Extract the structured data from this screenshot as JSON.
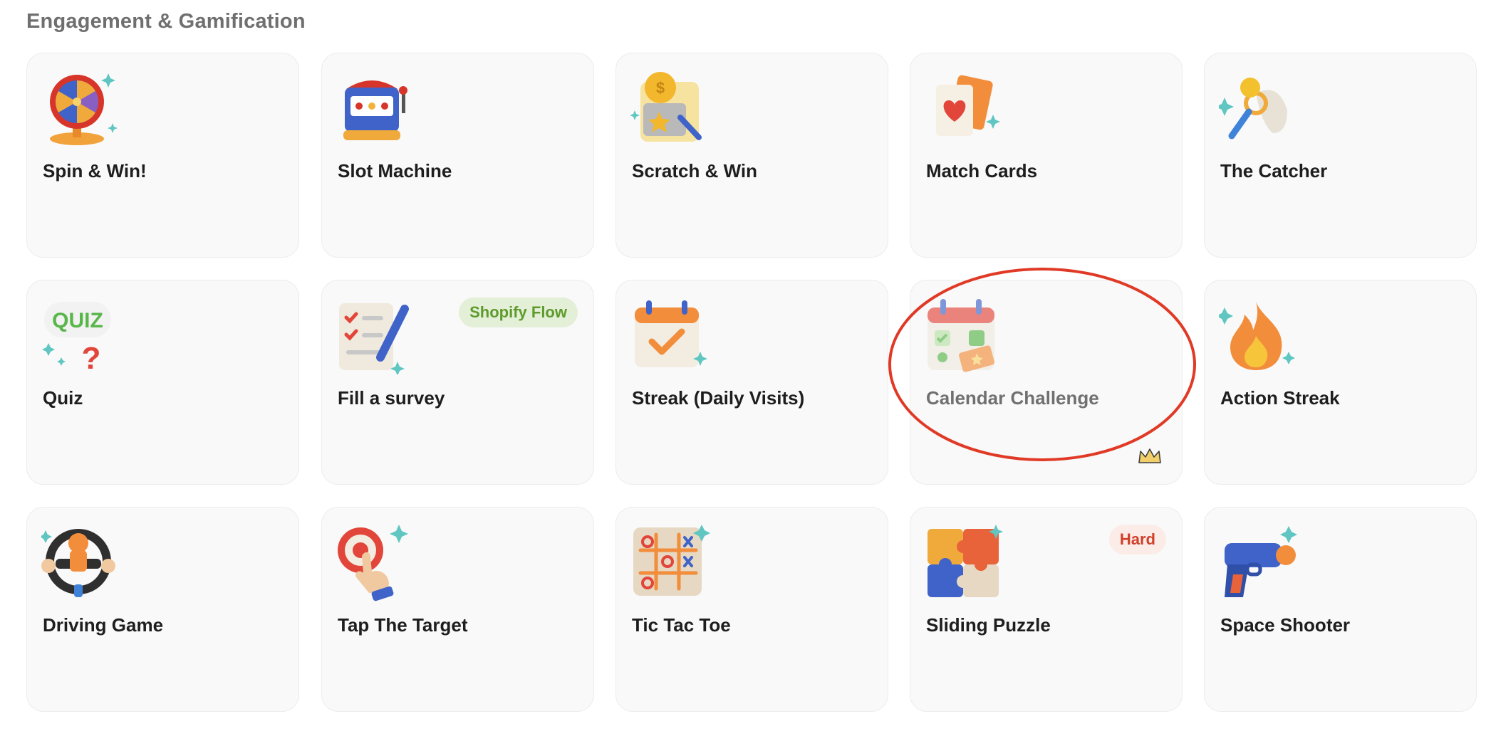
{
  "section": {
    "title": "Engagement & Gamification"
  },
  "cards": [
    {
      "label": "Spin & Win!",
      "icon": "spin-wheel-icon"
    },
    {
      "label": "Slot Machine",
      "icon": "slot-machine-icon"
    },
    {
      "label": "Scratch & Win",
      "icon": "scratch-card-icon"
    },
    {
      "label": "Match Cards",
      "icon": "playing-cards-icon"
    },
    {
      "label": "The Catcher",
      "icon": "catcher-net-icon"
    },
    {
      "label": "Quiz",
      "icon": "quiz-icon"
    },
    {
      "label": "Fill a survey",
      "icon": "survey-checklist-icon",
      "badge": "Shopify Flow"
    },
    {
      "label": "Streak (Daily Visits)",
      "icon": "calendar-check-icon"
    },
    {
      "label": "Calendar Challenge",
      "icon": "calendar-challenge-icon",
      "premium": true,
      "disabled": true
    },
    {
      "label": "Action Streak",
      "icon": "flame-icon"
    },
    {
      "label": "Driving Game",
      "icon": "steering-wheel-icon"
    },
    {
      "label": "Tap The Target",
      "icon": "tap-target-icon"
    },
    {
      "label": "Tic Tac Toe",
      "icon": "tic-tac-toe-icon"
    },
    {
      "label": "Sliding Puzzle",
      "icon": "puzzle-pieces-icon",
      "badge": "Hard"
    },
    {
      "label": "Space Shooter",
      "icon": "blaster-gun-icon"
    }
  ],
  "colors": {
    "flow_badge": "#5e9b2c",
    "hard_badge": "#d13f2a",
    "highlight": "#e03a26",
    "premium_crown": "#f3cf6a"
  }
}
